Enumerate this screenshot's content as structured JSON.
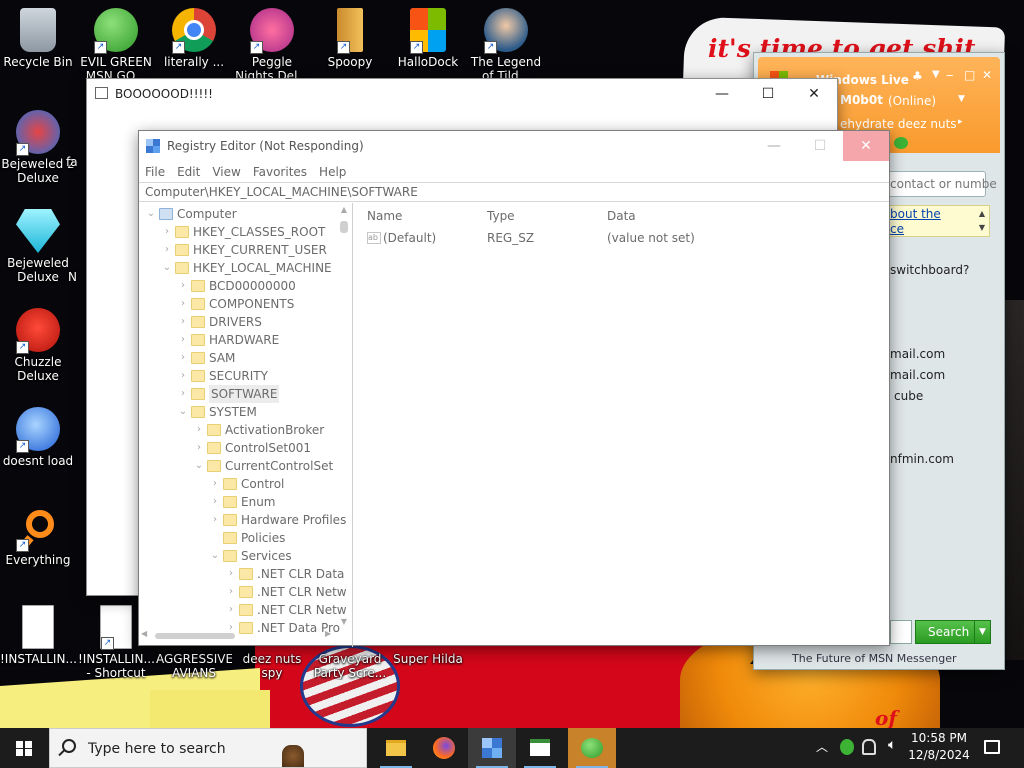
{
  "desktop": {
    "wallpaper_text_top": "it's time to get shit",
    "wallpaper_text_bottom": "of",
    "icons": [
      {
        "label": "Recycle Bin"
      },
      {
        "label": "EVIL GREEN MSN GO..."
      },
      {
        "label": "literally ..."
      },
      {
        "label": "Peggle Nights Del..."
      },
      {
        "label": "Spoopy"
      },
      {
        "label": "HalloDock"
      },
      {
        "label": "The Legend of Tild..."
      },
      {
        "label": "Bejeweled 2 Deluxe"
      },
      {
        "label": "Bejeweled Deluxe"
      },
      {
        "label": "Chuzzle Deluxe"
      },
      {
        "label": "doesnt load"
      },
      {
        "label": "Everything"
      },
      {
        "label": "!INSTALLIN..."
      },
      {
        "label": "!INSTALLIN... - Shortcut"
      },
      {
        "label": "AGGRESSIVE AVIANS"
      },
      {
        "label": "deez nuts spy"
      },
      {
        "label": "Graveyard Party Scre..."
      },
      {
        "label": "Super Hilda"
      }
    ],
    "partial_labels": [
      "fa",
      "N"
    ]
  },
  "msn": {
    "app_name": "Windows Live",
    "user": "M0b0t",
    "status": "(Online)",
    "personal_message": "ehydrate deez nuts",
    "search_placeholder": "contact or numbe",
    "info_link_1": "bout the",
    "info_link_2": "ce",
    "question": "switchboard?",
    "contacts": [
      "mail.com",
      "mail.com",
      "cube",
      "nfmin.com"
    ],
    "search_button": "Search",
    "footer": "The Future of MSN Messenger"
  },
  "boo_window": {
    "title": "BOOOOOOD!!!!!"
  },
  "regedit": {
    "title": "Registry Editor (Not Responding)",
    "menu": [
      "File",
      "Edit",
      "View",
      "Favorites",
      "Help"
    ],
    "address": "Computer\\HKEY_LOCAL_MACHINE\\SOFTWARE",
    "tree": [
      {
        "label": "Computer",
        "depth": 0,
        "expanded": true,
        "root": true
      },
      {
        "label": "HKEY_CLASSES_ROOT",
        "depth": 1,
        "expanded": false
      },
      {
        "label": "HKEY_CURRENT_USER",
        "depth": 1,
        "expanded": false
      },
      {
        "label": "HKEY_LOCAL_MACHINE",
        "depth": 1,
        "expanded": true
      },
      {
        "label": "BCD00000000",
        "depth": 2,
        "expanded": false
      },
      {
        "label": "COMPONENTS",
        "depth": 2,
        "expanded": false
      },
      {
        "label": "DRIVERS",
        "depth": 2,
        "expanded": false
      },
      {
        "label": "HARDWARE",
        "depth": 2,
        "expanded": false
      },
      {
        "label": "SAM",
        "depth": 2,
        "expanded": false
      },
      {
        "label": "SECURITY",
        "depth": 2,
        "expanded": false
      },
      {
        "label": "SOFTWARE",
        "depth": 2,
        "expanded": false,
        "selected": true
      },
      {
        "label": "SYSTEM",
        "depth": 2,
        "expanded": true
      },
      {
        "label": "ActivationBroker",
        "depth": 3,
        "expanded": false
      },
      {
        "label": "ControlSet001",
        "depth": 3,
        "expanded": false
      },
      {
        "label": "CurrentControlSet",
        "depth": 3,
        "expanded": true
      },
      {
        "label": "Control",
        "depth": 4,
        "expanded": false
      },
      {
        "label": "Enum",
        "depth": 4,
        "expanded": false
      },
      {
        "label": "Hardware Profiles",
        "depth": 4,
        "expanded": false
      },
      {
        "label": "Policies",
        "depth": 4,
        "expanded": null
      },
      {
        "label": "Services",
        "depth": 4,
        "expanded": true
      },
      {
        "label": ".NET CLR Data",
        "depth": 5,
        "expanded": false
      },
      {
        "label": ".NET CLR Netw",
        "depth": 5,
        "expanded": false
      },
      {
        "label": ".NET CLR Netw",
        "depth": 5,
        "expanded": false
      },
      {
        "label": ".NET Data Pro",
        "depth": 5,
        "expanded": false
      }
    ],
    "columns": [
      "Name",
      "Type",
      "Data"
    ],
    "values": [
      {
        "name": "(Default)",
        "type": "REG_SZ",
        "data": "(value not set)"
      }
    ]
  },
  "taskbar": {
    "search_placeholder": "Type here to search",
    "time": "10:58 PM",
    "date": "12/8/2024"
  }
}
